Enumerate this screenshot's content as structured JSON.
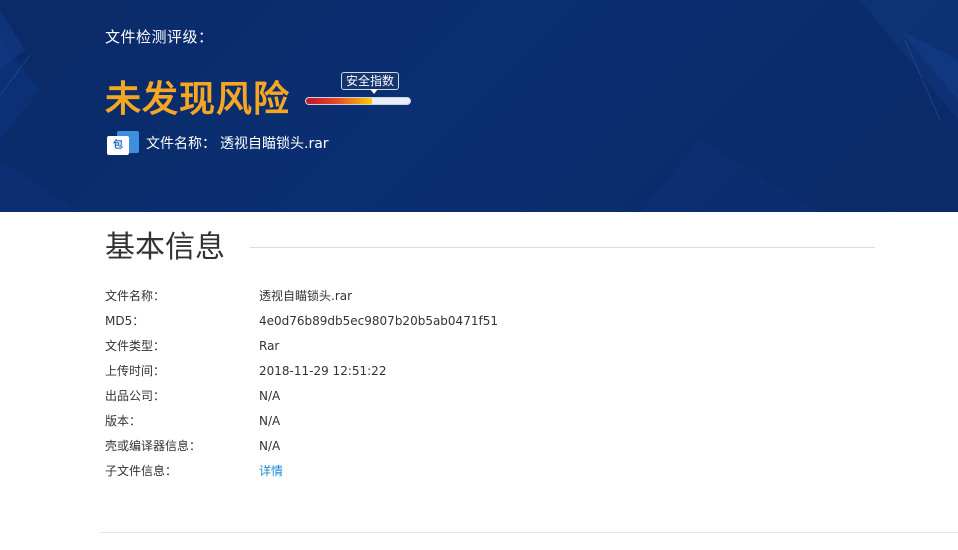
{
  "header": {
    "eval_label": "文件检测评级：",
    "risk_title": "未发现风险",
    "safety_tag": "安全指数",
    "safety_level_percent": 63,
    "file_icon_glyph": "包",
    "file_label": "文件名称：",
    "file_name": "透视自瞄锁头.rar",
    "colors": {
      "background": "#0b2a66",
      "risk_title": "#f5a623",
      "file_icon": "#3d8fe0"
    }
  },
  "basic_info": {
    "title": "基本信息",
    "rows": [
      {
        "key": "文件名称：",
        "value": "透视自瞄锁头.rar"
      },
      {
        "key": "MD5：",
        "value": "4e0d76b89db5ec9807b20b5ab0471f51"
      },
      {
        "key": "文件类型：",
        "value": "Rar"
      },
      {
        "key": "上传时间：",
        "value": "2018-11-29 12:51:22"
      },
      {
        "key": "出品公司：",
        "value": "N/A"
      },
      {
        "key": "版本：",
        "value": "N/A"
      },
      {
        "key": "壳或编译器信息：",
        "value": "N/A"
      },
      {
        "key": "子文件信息：",
        "value": "详情"
      }
    ],
    "link_color": "#1a8ad6"
  }
}
